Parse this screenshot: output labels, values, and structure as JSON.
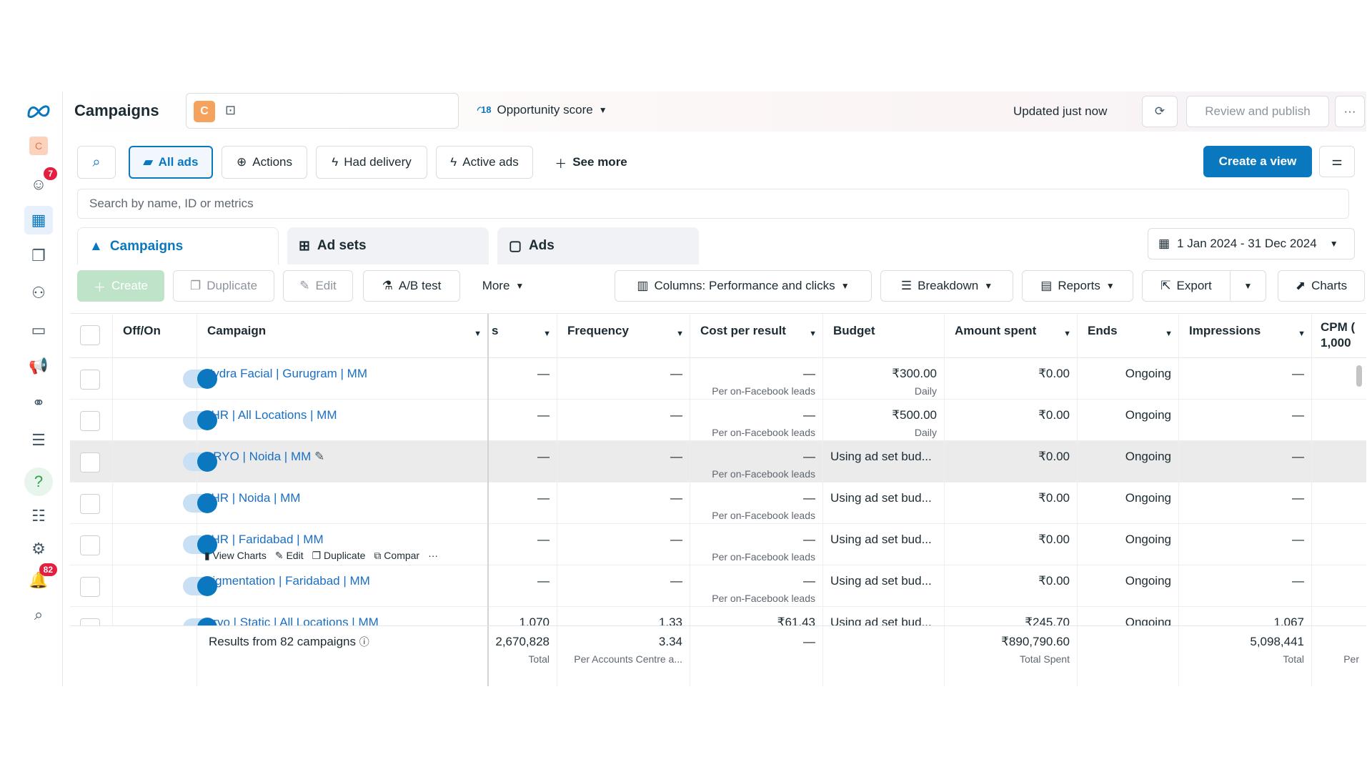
{
  "topbar": {
    "title": "Campaigns",
    "account_letter": "C",
    "opportunity_count": "18",
    "opportunity_label": "Opportunity score",
    "updated": "Updated just now",
    "review_publish": "Review and publish",
    "more": "···"
  },
  "rail": {
    "account_letter": "C",
    "notif_badge": "7",
    "alerts_badge": "82"
  },
  "filters": {
    "all_ads": "All ads",
    "actions": "Actions",
    "had_delivery": "Had delivery",
    "active_ads": "Active ads",
    "see_more": "See more",
    "create_view": "Create a view"
  },
  "search": {
    "placeholder": "Search by name, ID or metrics"
  },
  "level_tabs": {
    "campaigns": "Campaigns",
    "ad_sets": "Ad sets",
    "ads": "Ads"
  },
  "date_range": "1 Jan 2024 - 31 Dec 2024",
  "toolbar": {
    "create": "Create",
    "duplicate": "Duplicate",
    "edit": "Edit",
    "ab_test": "A/B test",
    "more": "More",
    "columns": "Columns: Performance and clicks",
    "breakdown": "Breakdown",
    "reports": "Reports",
    "export": "Export",
    "charts": "Charts"
  },
  "table": {
    "headers": {
      "off_on": "Off/On",
      "campaign": "Campaign",
      "results_trunc": "s",
      "frequency": "Frequency",
      "cost_per_result": "Cost per result",
      "budget": "Budget",
      "amount_spent": "Amount spent",
      "ends": "Ends",
      "impressions": "Impressions",
      "cpm_line1": "CPM (",
      "cpm_line2": "1,000"
    },
    "rows": [
      {
        "name": "Hydra Facial | Gurugram | MM",
        "results": "—",
        "frequency": "—",
        "cpr": "—",
        "cpr_sub": "Per on-Facebook leads",
        "budget": "₹300.00",
        "budget_sub": "Daily",
        "spent": "₹0.00",
        "ends": "Ongoing",
        "impressions": "—"
      },
      {
        "name": "LHR | All Locations | MM",
        "results": "—",
        "frequency": "—",
        "cpr": "—",
        "cpr_sub": "Per on-Facebook leads",
        "budget": "₹500.00",
        "budget_sub": "Daily",
        "spent": "₹0.00",
        "ends": "Ongoing",
        "impressions": "—"
      },
      {
        "name": "CRYO | Noida | MM",
        "results": "—",
        "frequency": "—",
        "cpr": "—",
        "cpr_sub": "Per on-Facebook leads",
        "budget": "Using ad set bud...",
        "budget_sub": "",
        "spent": "₹0.00",
        "ends": "Ongoing",
        "impressions": "—"
      },
      {
        "name": "LHR | Noida | MM",
        "results": "—",
        "frequency": "—",
        "cpr": "—",
        "cpr_sub": "Per on-Facebook leads",
        "budget": "Using ad set bud...",
        "budget_sub": "",
        "spent": "₹0.00",
        "ends": "Ongoing",
        "impressions": "—"
      },
      {
        "name": "LHR | Faridabad | MM",
        "results": "—",
        "frequency": "—",
        "cpr": "—",
        "cpr_sub": "Per on-Facebook leads",
        "budget": "Using ad set bud...",
        "budget_sub": "",
        "spent": "₹0.00",
        "ends": "Ongoing",
        "impressions": "—"
      },
      {
        "name": "Pigmentation | Faridabad | MM",
        "results": "—",
        "frequency": "—",
        "cpr": "—",
        "cpr_sub": "Per on-Facebook leads",
        "budget": "Using ad set bud...",
        "budget_sub": "",
        "spent": "₹0.00",
        "ends": "Ongoing",
        "impressions": "—"
      },
      {
        "name": "Cryo | Static | All Locations | MM",
        "results": "1,070",
        "frequency": "1.33",
        "cpr": "₹61.43",
        "cpr_sub": "",
        "budget": "Using ad set bud...",
        "budget_sub": "",
        "spent": "₹245.70",
        "ends": "Ongoing",
        "impressions": "1,067"
      }
    ],
    "row_actions": {
      "view_charts": "View Charts",
      "edit": "Edit",
      "duplicate": "Duplicate",
      "compare": "Compar",
      "more": "···"
    },
    "footer": {
      "label": "Results from 82 campaigns",
      "results": "2,670,828",
      "results_sub": "Total",
      "frequency": "3.34",
      "frequency_sub": "Per Accounts Centre a...",
      "cpr": "—",
      "spent": "₹890,790.60",
      "spent_sub": "Total Spent",
      "impressions": "5,098,441",
      "impressions_sub": "Total",
      "cpm_sub": "Per"
    }
  },
  "colors": {
    "accent": "#0a78be",
    "link": "#1a6fc4",
    "badge": "#e41e3f"
  }
}
